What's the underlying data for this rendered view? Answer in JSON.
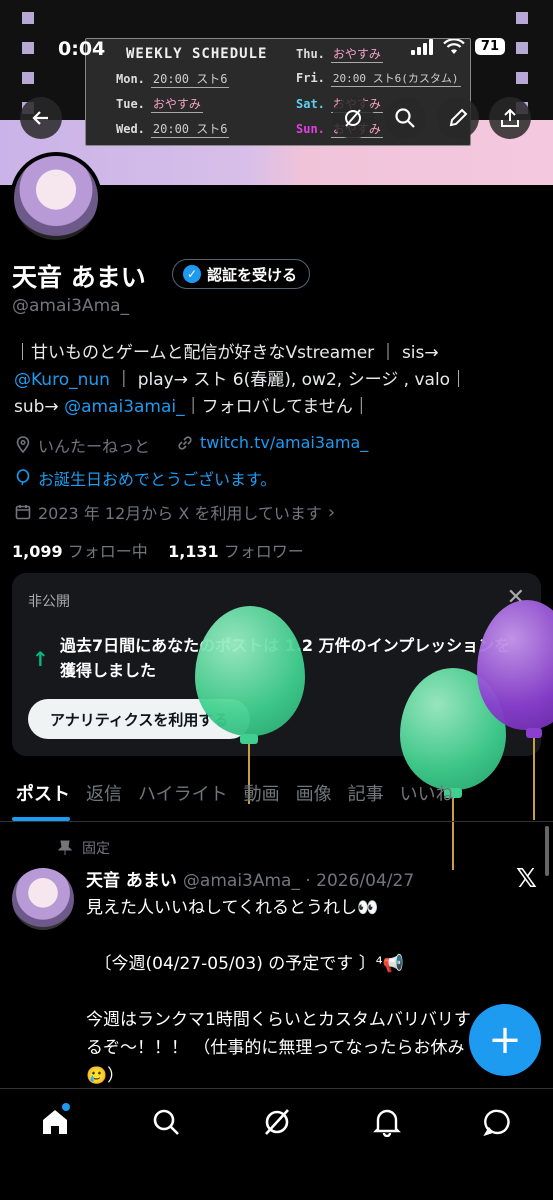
{
  "status_bar": {
    "time": "0:04",
    "battery": "71"
  },
  "banner": {
    "schedule_title": "WEEKLY SCHEDULE",
    "schedule": [
      {
        "day": "Mon.",
        "value": "20:00 スト6"
      },
      {
        "day": "Tue.",
        "value": "おやすみ"
      },
      {
        "day": "Wed.",
        "value": "20:00 スト6"
      },
      {
        "day": "Thu.",
        "value": "おやすみ"
      },
      {
        "day": "Fri.",
        "value": "20:00 スト6(カスタム)"
      },
      {
        "day": "Sat.",
        "value": "おやすみ"
      },
      {
        "day": "Sun.",
        "value": "おやすみ"
      }
    ]
  },
  "profile": {
    "name": "天音 あまい",
    "verify_label": "認証を受ける",
    "handle": "@amai3Ama_",
    "bio_line1": "｜甘いものとゲームと配信が好きなVstreamer ｜ sis→",
    "bio_mention1": "@Kuro_nun",
    "bio_line2": " ｜ play→ スト 6(春麗), ow2, シージ , valo｜",
    "bio_line3a": "sub→ ",
    "bio_mention2": "@amai3amai_",
    "bio_line3b": "｜フォロバしてません｜",
    "location": "いんたーねっと",
    "website": "twitch.tv/amai3ama_",
    "birthday": "お誕生日おめでとうございます。",
    "joined": "2023 年 12月から X を利用しています",
    "following_count": "1,099",
    "following_label": "フォロー中",
    "followers_count": "1,131",
    "followers_label": "フォロワー"
  },
  "analytics_card": {
    "private_label": "非公開",
    "message": "過去7日間にあなたのポストは 1.2 万件のインプレッションを獲得しました",
    "button_label": "アナリティクスを利用する"
  },
  "tabs": [
    {
      "label": "ポスト",
      "active": true
    },
    {
      "label": "返信",
      "active": false
    },
    {
      "label": "ハイライト",
      "active": false
    },
    {
      "label": "動画",
      "active": false
    },
    {
      "label": "画像",
      "active": false
    },
    {
      "label": "記事",
      "active": false
    },
    {
      "label": "いいね",
      "active": false
    }
  ],
  "pinned_post": {
    "pinned_label": "固定",
    "author": "天音 あまい",
    "handle_date": "@amai3Ama_ · 2026/04/27",
    "text": "見えた人いいねしてくれるとうれし👀\n\n　〔今週(04/27-05/03) の予定です 〕⁴📢\n\n今週はランクマ1時間くらいとカスタムバリバリするぞ〜！！！ （仕事的に無理ってなったらお休み🥲）"
  },
  "colors": {
    "accent": "#1d9bf0",
    "background": "#000000",
    "muted": "#71767b"
  }
}
